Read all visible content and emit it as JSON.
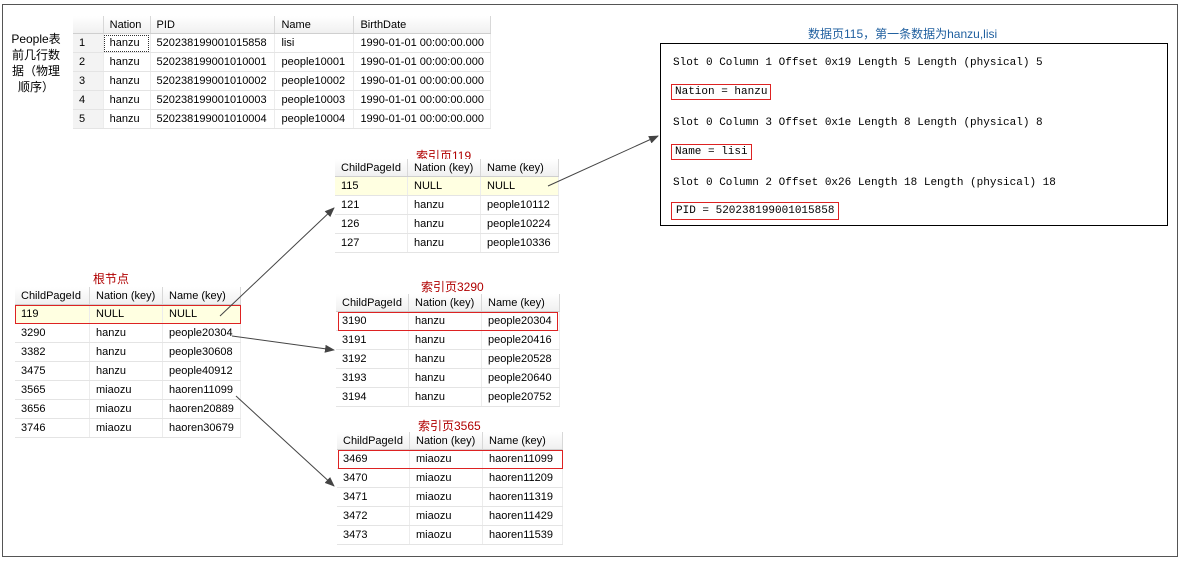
{
  "people_label": "People表前几行数据（物理顺序）",
  "people_label_lines": [
    "People表",
    "前几行数",
    "据（物理",
    "顺序）"
  ],
  "people_table": {
    "columns": [
      "",
      "Nation",
      "PID",
      "Name",
      "BirthDate"
    ],
    "rows": [
      [
        "1",
        "hanzu",
        "520238199001015858",
        "lisi",
        "1990-01-01 00:00:00.000"
      ],
      [
        "2",
        "hanzu",
        "520238199001010001",
        "people10001",
        "1990-01-01 00:00:00.000"
      ],
      [
        "3",
        "hanzu",
        "520238199001010002",
        "people10002",
        "1990-01-01 00:00:00.000"
      ],
      [
        "4",
        "hanzu",
        "520238199001010003",
        "people10003",
        "1990-01-01 00:00:00.000"
      ],
      [
        "5",
        "hanzu",
        "520238199001010004",
        "people10004",
        "1990-01-01 00:00:00.000"
      ]
    ]
  },
  "root": {
    "title": "根节点",
    "columns": [
      "ChildPageId",
      "Nation (key)",
      "Name (key)"
    ],
    "rows": [
      [
        "119",
        "NULL",
        "NULL"
      ],
      [
        "3290",
        "hanzu",
        "people20304"
      ],
      [
        "3382",
        "hanzu",
        "people30608"
      ],
      [
        "3475",
        "hanzu",
        "people40912"
      ],
      [
        "3565",
        "miaozu",
        "haoren11099"
      ],
      [
        "3656",
        "miaozu",
        "haoren20889"
      ],
      [
        "3746",
        "miaozu",
        "haoren30679"
      ]
    ]
  },
  "index119": {
    "title": "索引页119",
    "columns": [
      "ChildPageId",
      "Nation (key)",
      "Name (key)"
    ],
    "rows": [
      [
        "115",
        "NULL",
        "NULL"
      ],
      [
        "121",
        "hanzu",
        "people10112"
      ],
      [
        "126",
        "hanzu",
        "people10224"
      ],
      [
        "127",
        "hanzu",
        "people10336"
      ]
    ]
  },
  "index3290": {
    "title": "索引页3290",
    "columns": [
      "ChildPageId",
      "Nation (key)",
      "Name (key)"
    ],
    "rows": [
      [
        "3190",
        "hanzu",
        "people20304"
      ],
      [
        "3191",
        "hanzu",
        "people20416"
      ],
      [
        "3192",
        "hanzu",
        "people20528"
      ],
      [
        "3193",
        "hanzu",
        "people20640"
      ],
      [
        "3194",
        "hanzu",
        "people20752"
      ]
    ]
  },
  "index3565": {
    "title": "索引页3565",
    "columns": [
      "ChildPageId",
      "Nation (key)",
      "Name (key)"
    ],
    "rows": [
      [
        "3469",
        "miaozu",
        "haoren11099"
      ],
      [
        "3470",
        "miaozu",
        "haoren11209"
      ],
      [
        "3471",
        "miaozu",
        "haoren11319"
      ],
      [
        "3472",
        "miaozu",
        "haoren11429"
      ],
      [
        "3473",
        "miaozu",
        "haoren11539"
      ]
    ]
  },
  "datapage": {
    "title": "数据页115，第一条数据为hanzu,lisi",
    "slot0": "Slot 0 Column 1 Offset 0x19 Length 5 Length (physical) 5",
    "nation": "Nation = hanzu",
    "slot1": "Slot 0 Column 3 Offset 0x1e Length 8 Length (physical) 8",
    "name": "Name = lisi",
    "slot2": "Slot 0 Column 2 Offset 0x26 Length 18 Length (physical) 18",
    "pid": "PID = 520238199001015858"
  }
}
